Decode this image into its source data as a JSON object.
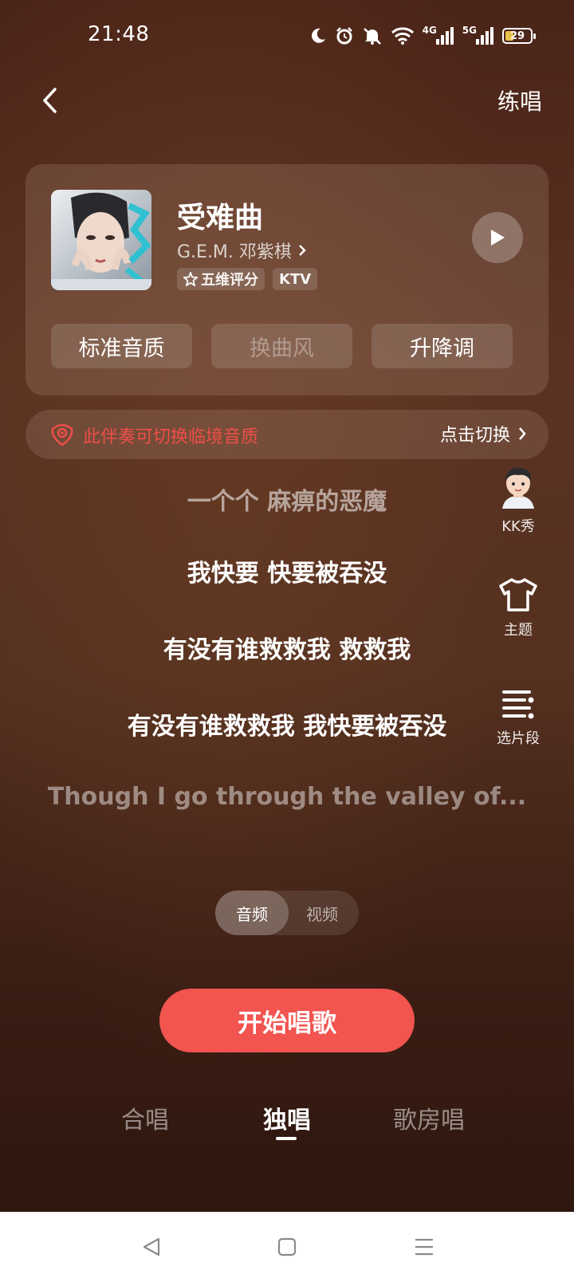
{
  "status_bar": {
    "time": "21:48",
    "icons": [
      "moon-icon",
      "alarm-icon",
      "mute-icon",
      "wifi-icon",
      "signal-4g-icon",
      "signal-5g-icon",
      "battery-icon"
    ],
    "net1": "4G",
    "net2": "5G",
    "battery_level": "29"
  },
  "header": {
    "practice_label": "练唱"
  },
  "song": {
    "title": "受难曲",
    "artist": "G.E.M. 邓紫棋",
    "tags": [
      "五维评分",
      "KTV"
    ]
  },
  "options": {
    "quality": "标准音质",
    "style": "换曲风",
    "key": "升降调"
  },
  "banner": {
    "text": "此伴奏可切换临境音质",
    "action": "点击切换"
  },
  "lyrics": [
    "一个个 麻痹的恶魔",
    "我快要 快要被吞没",
    "有没有谁救救我 救救我",
    "有没有谁救救我 我快要被吞没",
    "Though I go through the valley of..."
  ],
  "side_tools": {
    "kk_show": "KK秀",
    "theme": "主题",
    "segment": "选片段"
  },
  "media_toggle": {
    "audio": "音频",
    "video": "视频"
  },
  "start_button": "开始唱歌",
  "mode_tabs": {
    "chorus": "合唱",
    "solo": "独唱",
    "room": "歌房唱"
  },
  "colors": {
    "accent": "#f25450",
    "banner_text": "#ee4f49"
  }
}
